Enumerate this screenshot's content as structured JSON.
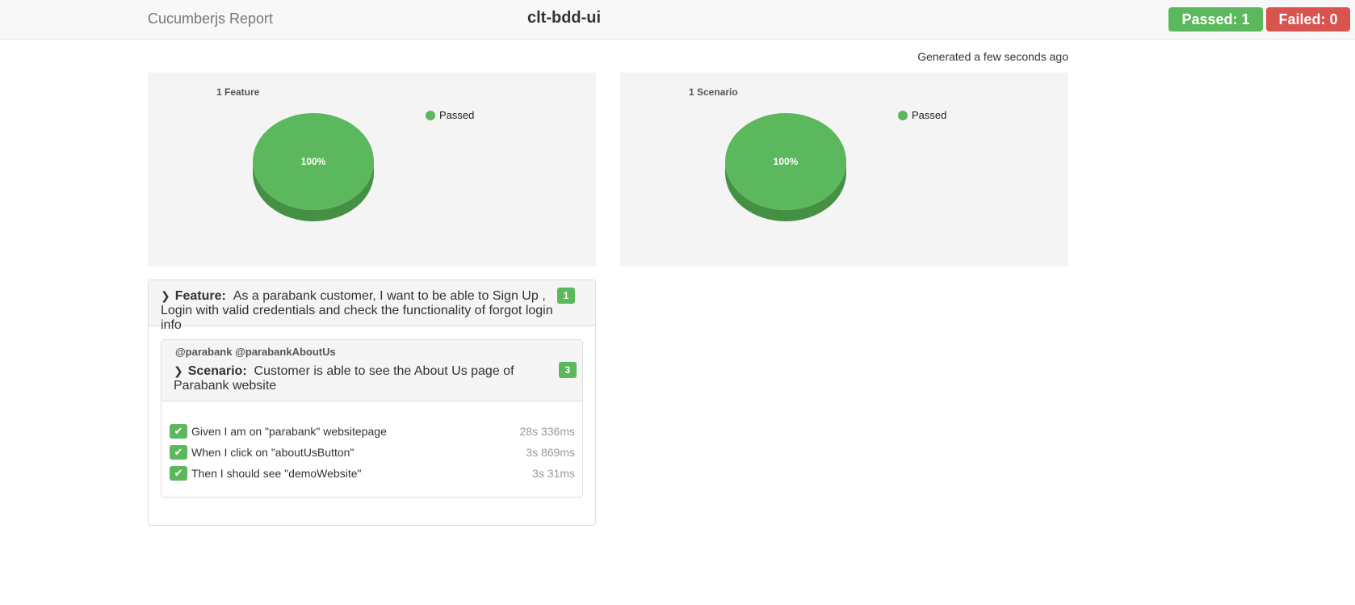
{
  "header": {
    "brand": "Cucumberjs Report",
    "project": "clt-bdd-ui",
    "passed_label": "Passed: 1",
    "failed_label": "Failed: 0"
  },
  "generated": "Generated a few seconds ago",
  "colors": {
    "passed": "#5cb85c",
    "failed": "#d9534f"
  },
  "charts": [
    {
      "title": "1 Feature",
      "legend": "Passed",
      "slice_label": "100%"
    },
    {
      "title": "1 Scenario",
      "legend": "Passed",
      "slice_label": "100%"
    }
  ],
  "chart_data": [
    {
      "type": "pie",
      "title": "1 Feature",
      "categories": [
        "Passed"
      ],
      "values": [
        100
      ],
      "legend": "top-right"
    },
    {
      "type": "pie",
      "title": "1 Scenario",
      "categories": [
        "Passed"
      ],
      "values": [
        100
      ],
      "legend": "top-right"
    }
  ],
  "feature": {
    "keyword": "Feature:",
    "name": "As a parabank customer, I want to be able to Sign Up , Login with valid credentials and check the functionality of forgot login info",
    "count": "1",
    "scenario": {
      "tags": "@parabank @parabankAboutUs",
      "keyword": "Scenario:",
      "name": "Customer is able to see the About Us page of Parabank website",
      "count": "3",
      "steps": [
        {
          "text": "Given I am on \"parabank\" websitepage",
          "duration": "28s 336ms"
        },
        {
          "text": "When I click on \"aboutUsButton\"",
          "duration": "3s 869ms"
        },
        {
          "text": "Then I should see \"demoWebsite\"",
          "duration": "3s 31ms"
        }
      ]
    }
  }
}
